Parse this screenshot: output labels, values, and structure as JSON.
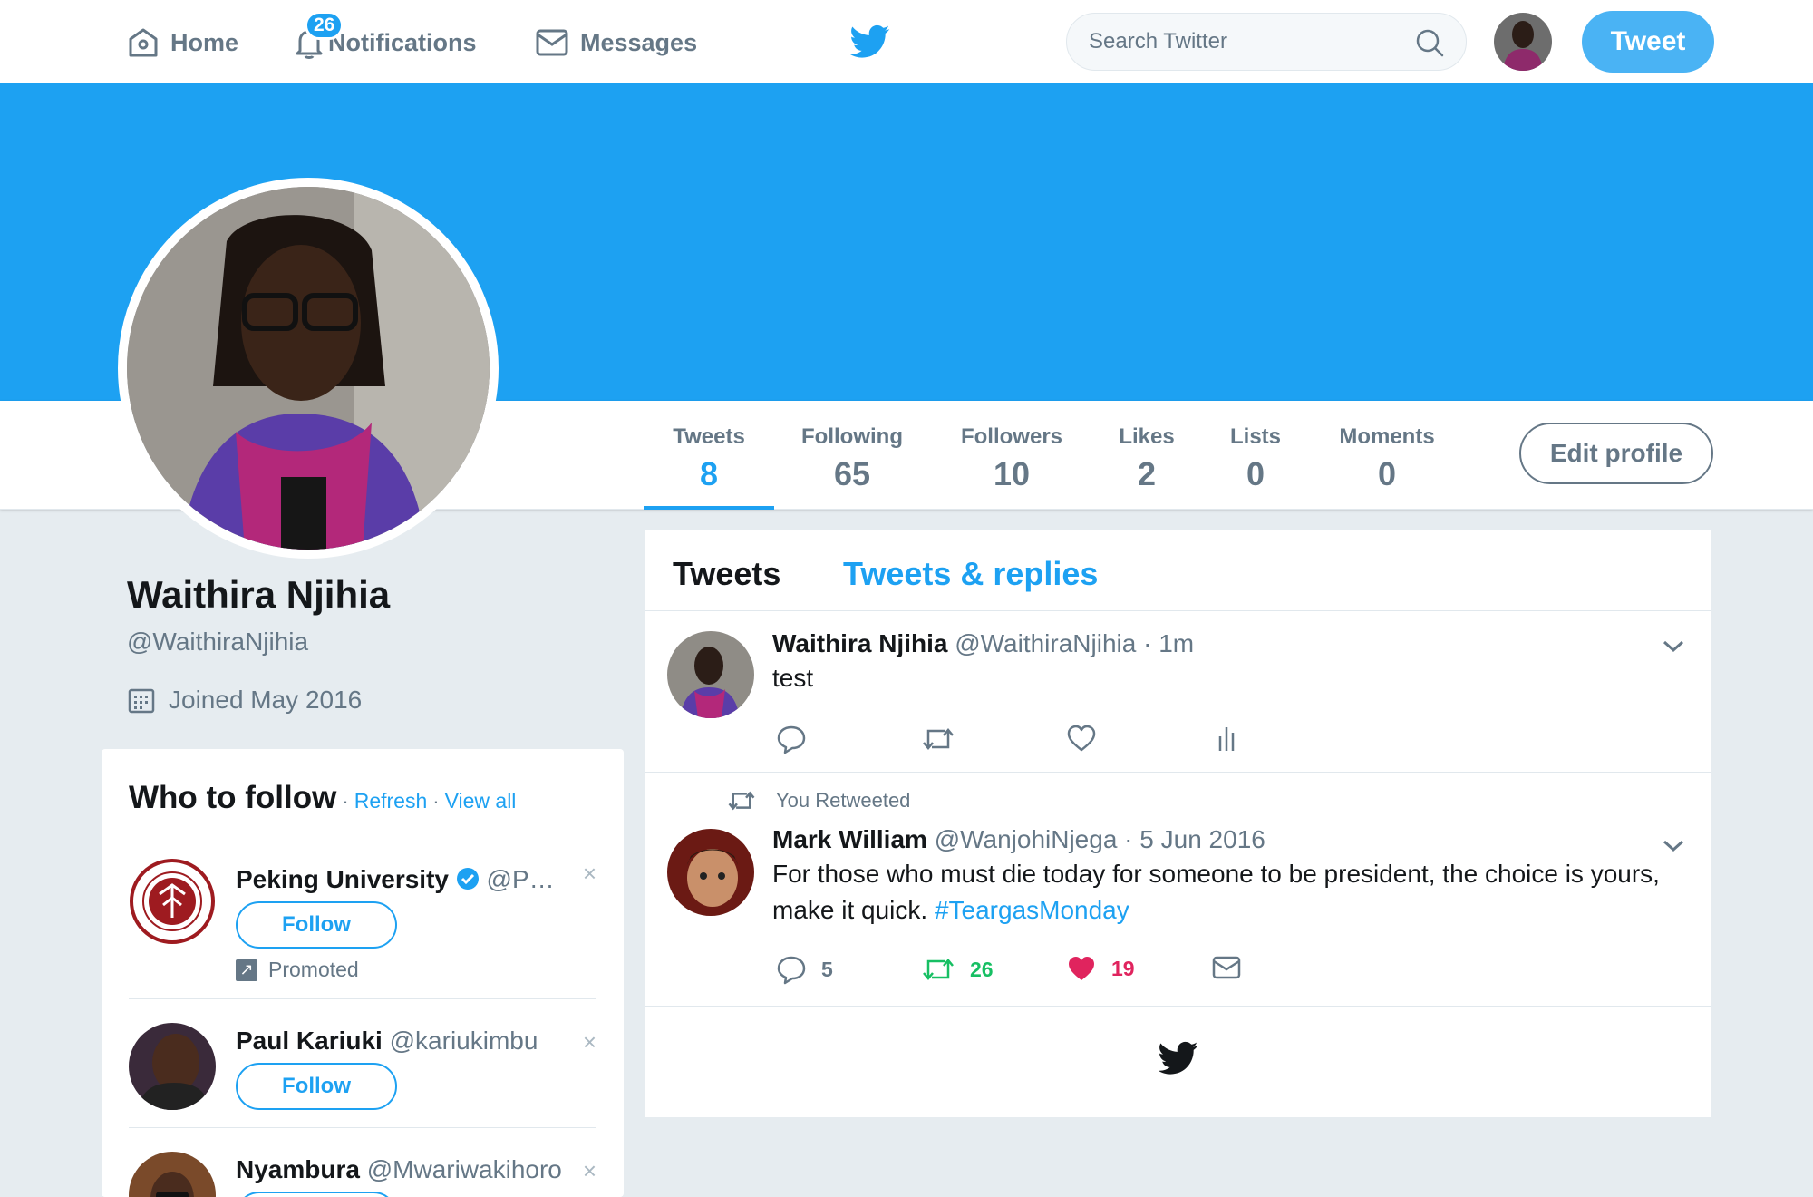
{
  "nav": {
    "home_label": "Home",
    "notifications_label": "Notifications",
    "notifications_count": "26",
    "messages_label": "Messages",
    "search_placeholder": "Search Twitter",
    "tweet_button_label": "Tweet"
  },
  "colors": {
    "brand_blue": "#1da1f2",
    "retweet_green": "#17bf63",
    "like_red": "#e0245e",
    "text_gray": "#657786"
  },
  "profile": {
    "name": "Waithira Njihia",
    "handle": "@WaithiraNjihia",
    "joined": "Joined May 2016",
    "edit_profile_label": "Edit profile",
    "stats": [
      {
        "label": "Tweets",
        "value": "8"
      },
      {
        "label": "Following",
        "value": "65"
      },
      {
        "label": "Followers",
        "value": "10"
      },
      {
        "label": "Likes",
        "value": "2"
      },
      {
        "label": "Lists",
        "value": "0"
      },
      {
        "label": "Moments",
        "value": "0"
      }
    ]
  },
  "who_to_follow": {
    "title": "Who to follow",
    "refresh_label": "Refresh",
    "view_all_label": "View all",
    "separator": "·",
    "items": [
      {
        "name": "Peking University",
        "handle": "@P…",
        "follow_label": "Follow",
        "promoted_label": "Promoted",
        "close": "×"
      },
      {
        "name": "Paul Kariuki",
        "handle": "@kariukimbu",
        "follow_label": "Follow",
        "close": "×"
      },
      {
        "name": "Nyambura",
        "handle": "@Mwariwakihoro",
        "close": "×"
      }
    ]
  },
  "timeline": {
    "tabs": [
      "Tweets",
      "Tweets & replies"
    ],
    "tweets": [
      {
        "author": "Waithira Njihia",
        "meta": " @WaithiraNjihia · 1m",
        "text": "test"
      },
      {
        "retweet_label": "You Retweeted",
        "author": "Mark William",
        "meta": " @WanjohiNjega · 5 Jun 2016",
        "text": "For those who must die today for someone to be president, the choice is yours, make it quick. ",
        "hashtag": "#TeargasMonday",
        "reply_count": "5",
        "retweet_count": "26",
        "like_count": "19"
      }
    ]
  }
}
